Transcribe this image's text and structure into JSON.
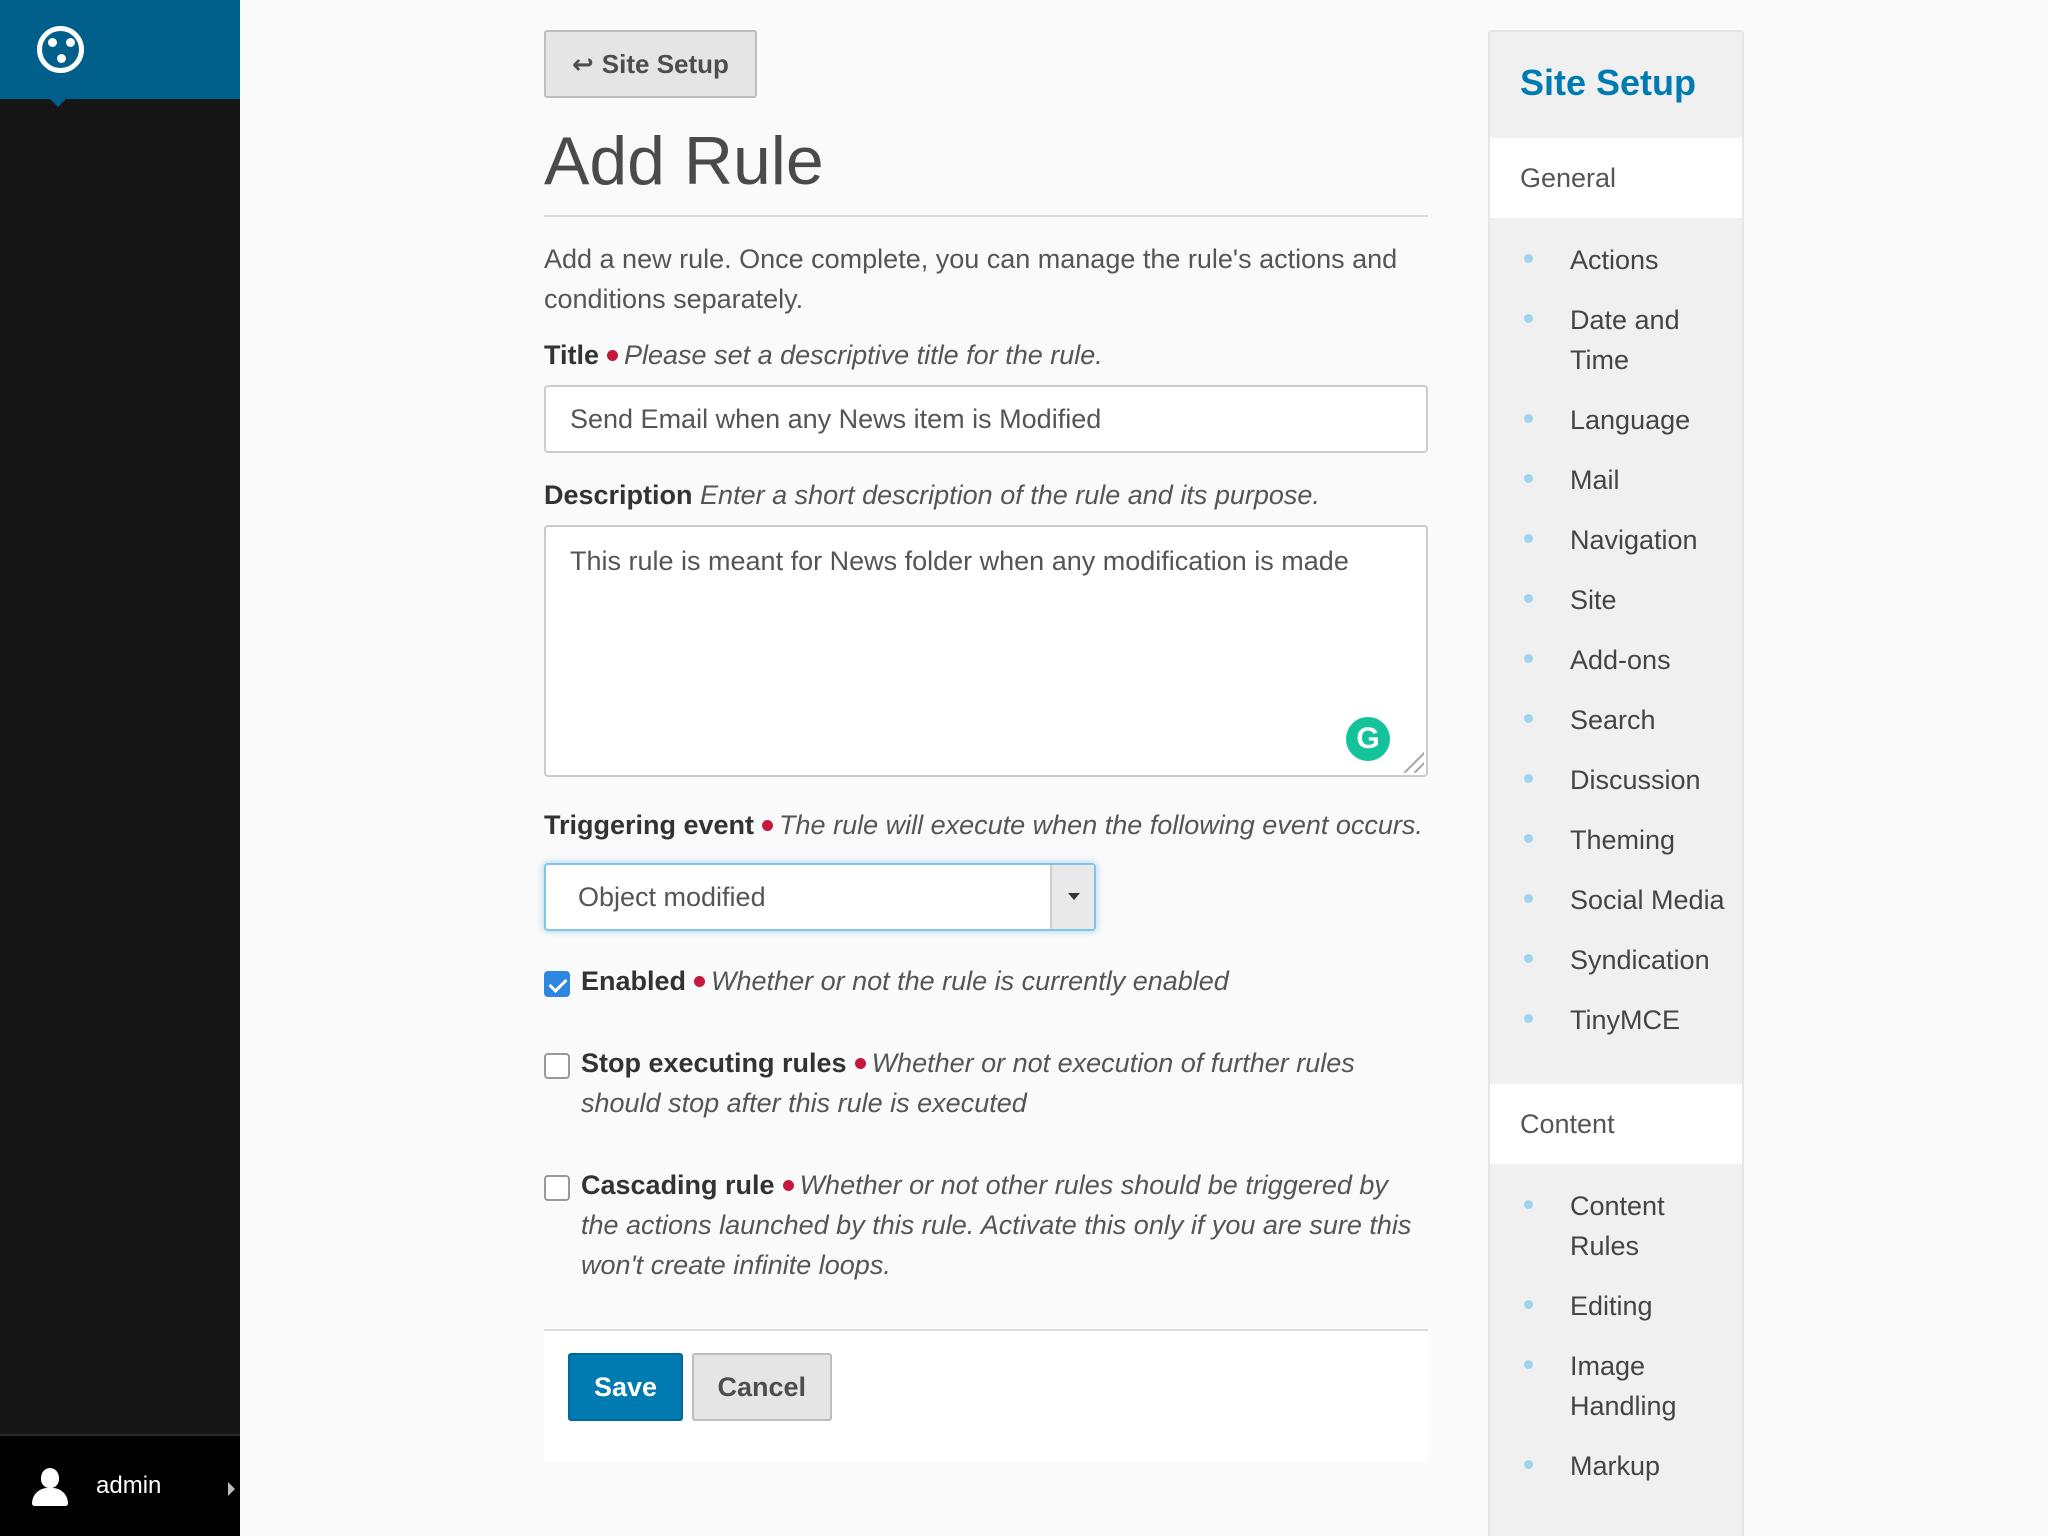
{
  "toolbar": {
    "user_name": "admin"
  },
  "main": {
    "back_label": "Site Setup",
    "title": "Add Rule",
    "intro": "Add a new rule. Once complete, you can manage the rule's actions and conditions separately.",
    "fields": {
      "title": {
        "label": "Title",
        "help": "Please set a descriptive title for the rule.",
        "value": "Send Email when any News item is Modified"
      },
      "description": {
        "label": "Description",
        "help": "Enter a short description of the rule and its purpose.",
        "value": "This rule is meant for News folder when any modification is made"
      },
      "event": {
        "label": "Triggering event",
        "help": "The rule will execute when the following event occurs.",
        "selected": "Object modified"
      },
      "enabled": {
        "label": "Enabled",
        "help": "Whether or not the rule is currently enabled",
        "checked": true
      },
      "stop": {
        "label": "Stop executing rules",
        "help": "Whether or not execution of further rules should stop after this rule is executed",
        "checked": false
      },
      "cascading": {
        "label": "Cascading rule",
        "help": "Whether or not other rules should be triggered by the actions launched by this rule. Activate this only if you are sure this won't create infinite loops.",
        "checked": false
      }
    },
    "save_label": "Save",
    "cancel_label": "Cancel"
  },
  "portlet": {
    "header": "Site Setup",
    "sections": [
      {
        "title": "General",
        "items": [
          "Actions",
          "Date and Time",
          "Language",
          "Mail",
          "Navigation",
          "Site",
          "Add-ons",
          "Search",
          "Discussion",
          "Theming",
          "Social Media",
          "Syndication",
          "TinyMCE"
        ]
      },
      {
        "title": "Content",
        "items": [
          "Content Rules",
          "Editing",
          "Image Handling",
          "Markup"
        ]
      }
    ]
  },
  "colors": {
    "brand": "#005f8b",
    "link": "#007bb1",
    "required": "#c4183c",
    "checkbox": "#2c87e0"
  }
}
